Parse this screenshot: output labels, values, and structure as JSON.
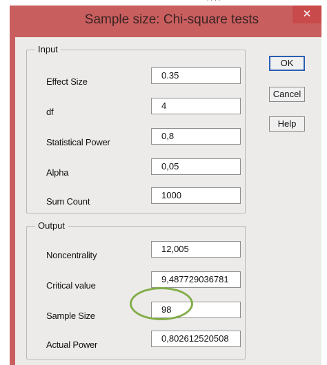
{
  "window": {
    "title": "Sample size: Chi-square tests",
    "close_glyph": "✕"
  },
  "input_group": {
    "title": "Input",
    "rows": [
      {
        "label": "Effect Size",
        "value": "0.35"
      },
      {
        "label": "df",
        "value": "4"
      },
      {
        "label": "Statistical Power",
        "value": "0,8"
      },
      {
        "label": "Alpha",
        "value": "0,05"
      },
      {
        "label": "Sum Count",
        "value": "1000"
      }
    ]
  },
  "output_group": {
    "title": "Output",
    "rows": [
      {
        "label": "Noncentrality",
        "value": "12,005"
      },
      {
        "label": "Critical value",
        "value": "9,487729036781"
      },
      {
        "label": "Sample Size",
        "value": "98"
      },
      {
        "label": "Actual Power",
        "value": "0,802612520508"
      }
    ]
  },
  "buttons": {
    "ok": "OK",
    "cancel": "Cancel",
    "help": "Help"
  },
  "colors": {
    "titlebar": "#c95e5e",
    "highlight_circle": "#82ad47",
    "ok_border": "#2b5fb3"
  }
}
